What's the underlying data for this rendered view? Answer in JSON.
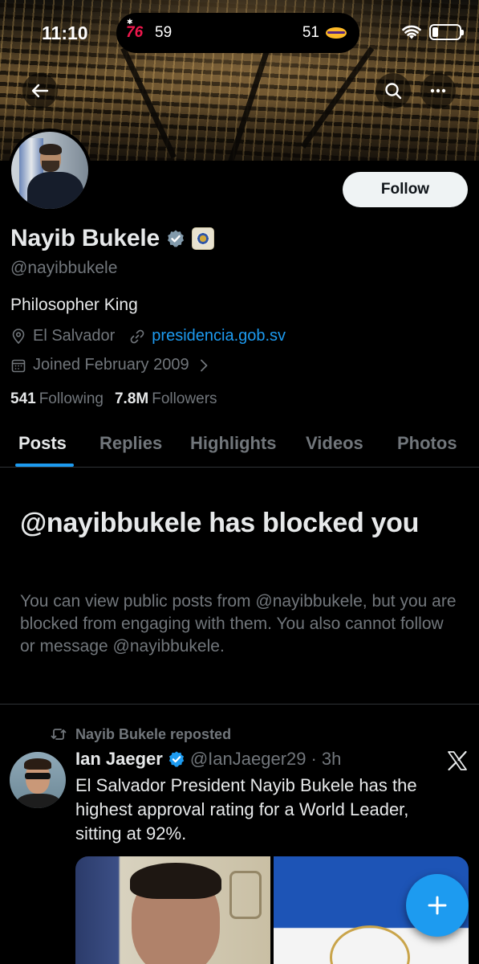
{
  "status_bar": {
    "time": "11:10",
    "live_activity": {
      "team_left": "76",
      "score_left": "59",
      "score_right": "51"
    }
  },
  "banner": {
    "icons": {
      "back": "arrow-left-icon",
      "search": "search-icon",
      "more": "more-horizontal-icon"
    }
  },
  "profile": {
    "follow_label": "Follow",
    "display_name": "Nayib Bukele",
    "handle": "@nayibbukele",
    "bio": "Philosopher King",
    "location": "El Salvador",
    "website": "presidencia.gob.sv",
    "joined": "Joined February 2009",
    "following_count": "541",
    "following_label": "Following",
    "followers_count": "7.8M",
    "followers_label": "Followers",
    "colors": {
      "link": "#1d9bf0",
      "verified_gray": "#829aab"
    }
  },
  "tabs": [
    {
      "label": "Posts",
      "active": true
    },
    {
      "label": "Replies"
    },
    {
      "label": "Highlights"
    },
    {
      "label": "Videos"
    },
    {
      "label": "Photos"
    }
  ],
  "blocked": {
    "title": "@nayibbukele has blocked you",
    "description": "You can view public posts from @nayibbukele, but you are blocked from engaging with them. You also cannot follow or message @nayibbukele."
  },
  "post": {
    "repost_label": "Nayib Bukele reposted",
    "author": "Ian Jaeger",
    "handle": "@IanJaeger29",
    "separator": "·",
    "time": "3h",
    "text": "El Salvador President Nayib Bukele has the highest approval rating for a World Leader, sitting at 92%.",
    "colors": {
      "verified_blue": "#1d9bf0"
    }
  },
  "fab": {
    "icon": "plus-icon"
  }
}
